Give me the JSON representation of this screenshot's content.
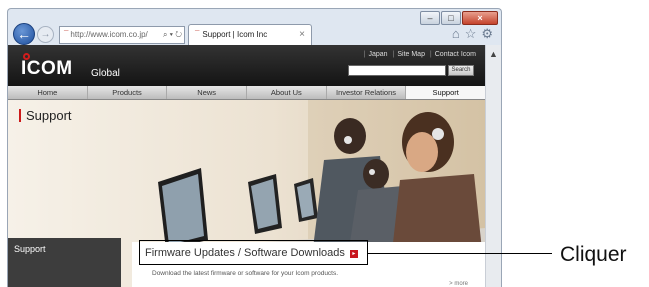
{
  "browser": {
    "address_url": "http://www.icom.co.jp/",
    "address_icons": "⌕ ▾ ↻",
    "tab_title": "Support | Icom Inc",
    "tab_close": "×",
    "window_controls": {
      "minimize": "–",
      "maximize": "□",
      "close": "×"
    },
    "toolbar_icons": {
      "home": "⌂",
      "favorites": "☆",
      "tools": "⚙"
    }
  },
  "site": {
    "logo": "ICOM",
    "logo_subtitle": "Global",
    "top_links": [
      "Japan",
      "Site Map",
      "Contact Icom"
    ],
    "search_button": "Search",
    "nav": [
      "Home",
      "Products",
      "News",
      "About Us",
      "Investor Relations",
      "Support"
    ],
    "active_nav": "Support",
    "page_title": "Support",
    "sidebar_title": "Support",
    "firmware_link": "Firmware Updates / Software Downloads",
    "firmware_description": "Download the latest firmware or software for your Icom products.",
    "more_link": "> more"
  },
  "annotation": {
    "label": "Cliquer"
  },
  "colors": {
    "brand_red": "#c8161d",
    "header_dark": "#1a1a1a",
    "sidebar_dark": "#3d3d3d"
  }
}
